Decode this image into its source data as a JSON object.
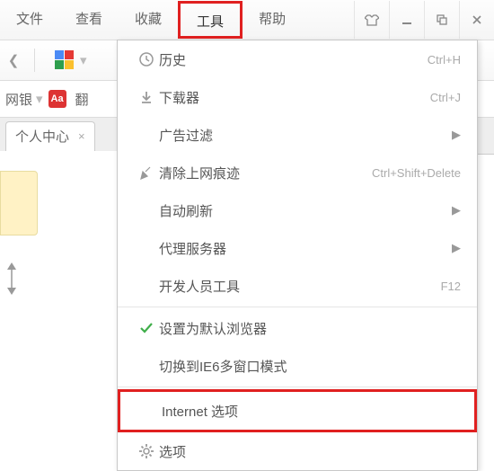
{
  "menubar": {
    "items": [
      "文件",
      "查看",
      "收藏",
      "工具",
      "帮助"
    ],
    "selected": 3
  },
  "bookbar": {
    "label1": "网银",
    "label2": "翻"
  },
  "tab": {
    "title": "个人中心",
    "close": "×"
  },
  "dropdown": {
    "history": {
      "label": "历史",
      "shortcut": "Ctrl+H"
    },
    "downloads": {
      "label": "下载器",
      "shortcut": "Ctrl+J"
    },
    "adblock": {
      "label": "广告过滤"
    },
    "cleartrace": {
      "label": "清除上网痕迹",
      "shortcut": "Ctrl+Shift+Delete"
    },
    "autorefresh": {
      "label": "自动刷新"
    },
    "proxy": {
      "label": "代理服务器"
    },
    "devtools": {
      "label": "开发人员工具",
      "shortcut": "F12"
    },
    "setdefault": {
      "label": "设置为默认浏览器"
    },
    "ie6mode": {
      "label": "切换到IE6多窗口模式"
    },
    "internetoptions": {
      "label": "Internet 选项"
    },
    "options": {
      "label": "选项"
    }
  }
}
